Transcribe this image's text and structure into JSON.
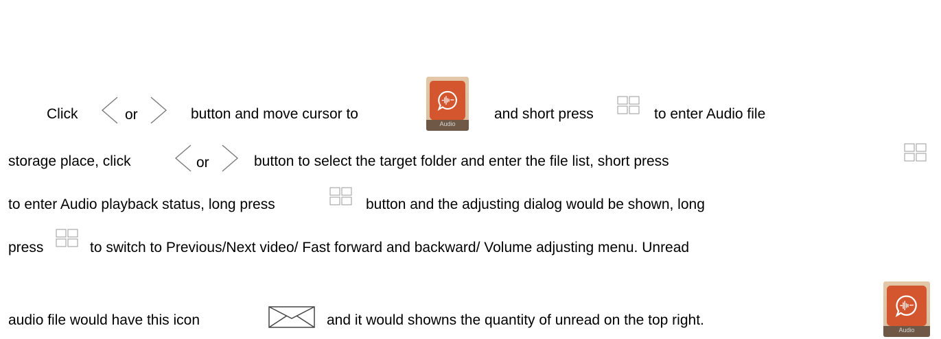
{
  "instructions": {
    "line1": {
      "click": "Click",
      "or": "or",
      "seg": "button and move cursor to",
      "seg2": "and short press",
      "seg3": "to enter Audio file"
    },
    "line2": {
      "seg1": "storage place, click",
      "or": "or",
      "seg2": "button to select the target folder and enter the file list, short press"
    },
    "line3": {
      "seg1": "to enter Audio playback status, long press",
      "seg2": "button and the adjusting dialog would be shown, long"
    },
    "line4": {
      "seg1": "press",
      "seg2": "to switch to Previous/Next video/ Fast forward and backward/ Volume adjusting menu. Unread"
    },
    "line5": {
      "seg1": "audio file would have this icon",
      "seg2": "and it would showns the quantity of unread on the top right."
    }
  },
  "audio_app_icon": {
    "caption": "Audio",
    "icon": "audio-message-icon",
    "color": "#d3562f"
  },
  "icons": {
    "left_button": "chevron-left-icon",
    "right_button": "chevron-right-icon",
    "ok_button": "grid-button-icon",
    "unread": "envelope-icon"
  }
}
